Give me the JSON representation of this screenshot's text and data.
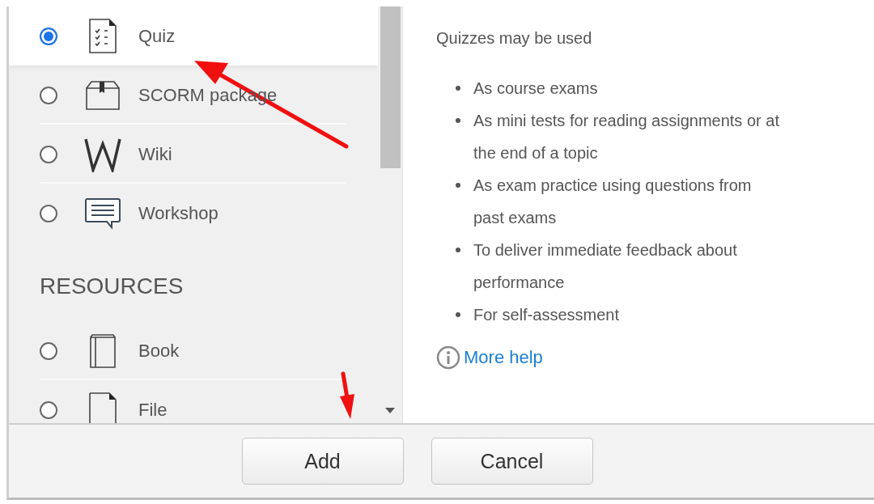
{
  "activities": [
    {
      "label": "Quiz",
      "selected": true
    },
    {
      "label": "SCORM package",
      "selected": false
    },
    {
      "label": "Wiki",
      "selected": false
    },
    {
      "label": "Workshop",
      "selected": false
    }
  ],
  "resources": {
    "heading": "RESOURCES",
    "items": [
      {
        "label": "Book",
        "selected": false
      },
      {
        "label": "File",
        "selected": false
      }
    ]
  },
  "help": {
    "intro": "Quizzes may be used",
    "bullets": [
      "As course exams",
      "As mini tests for reading assignments or at the end of a topic",
      "As exam practice using questions from past exams",
      "To deliver immediate feedback about performance",
      "For self-assessment"
    ],
    "link": "More help"
  },
  "buttons": [
    "Add",
    "Cancel"
  ]
}
